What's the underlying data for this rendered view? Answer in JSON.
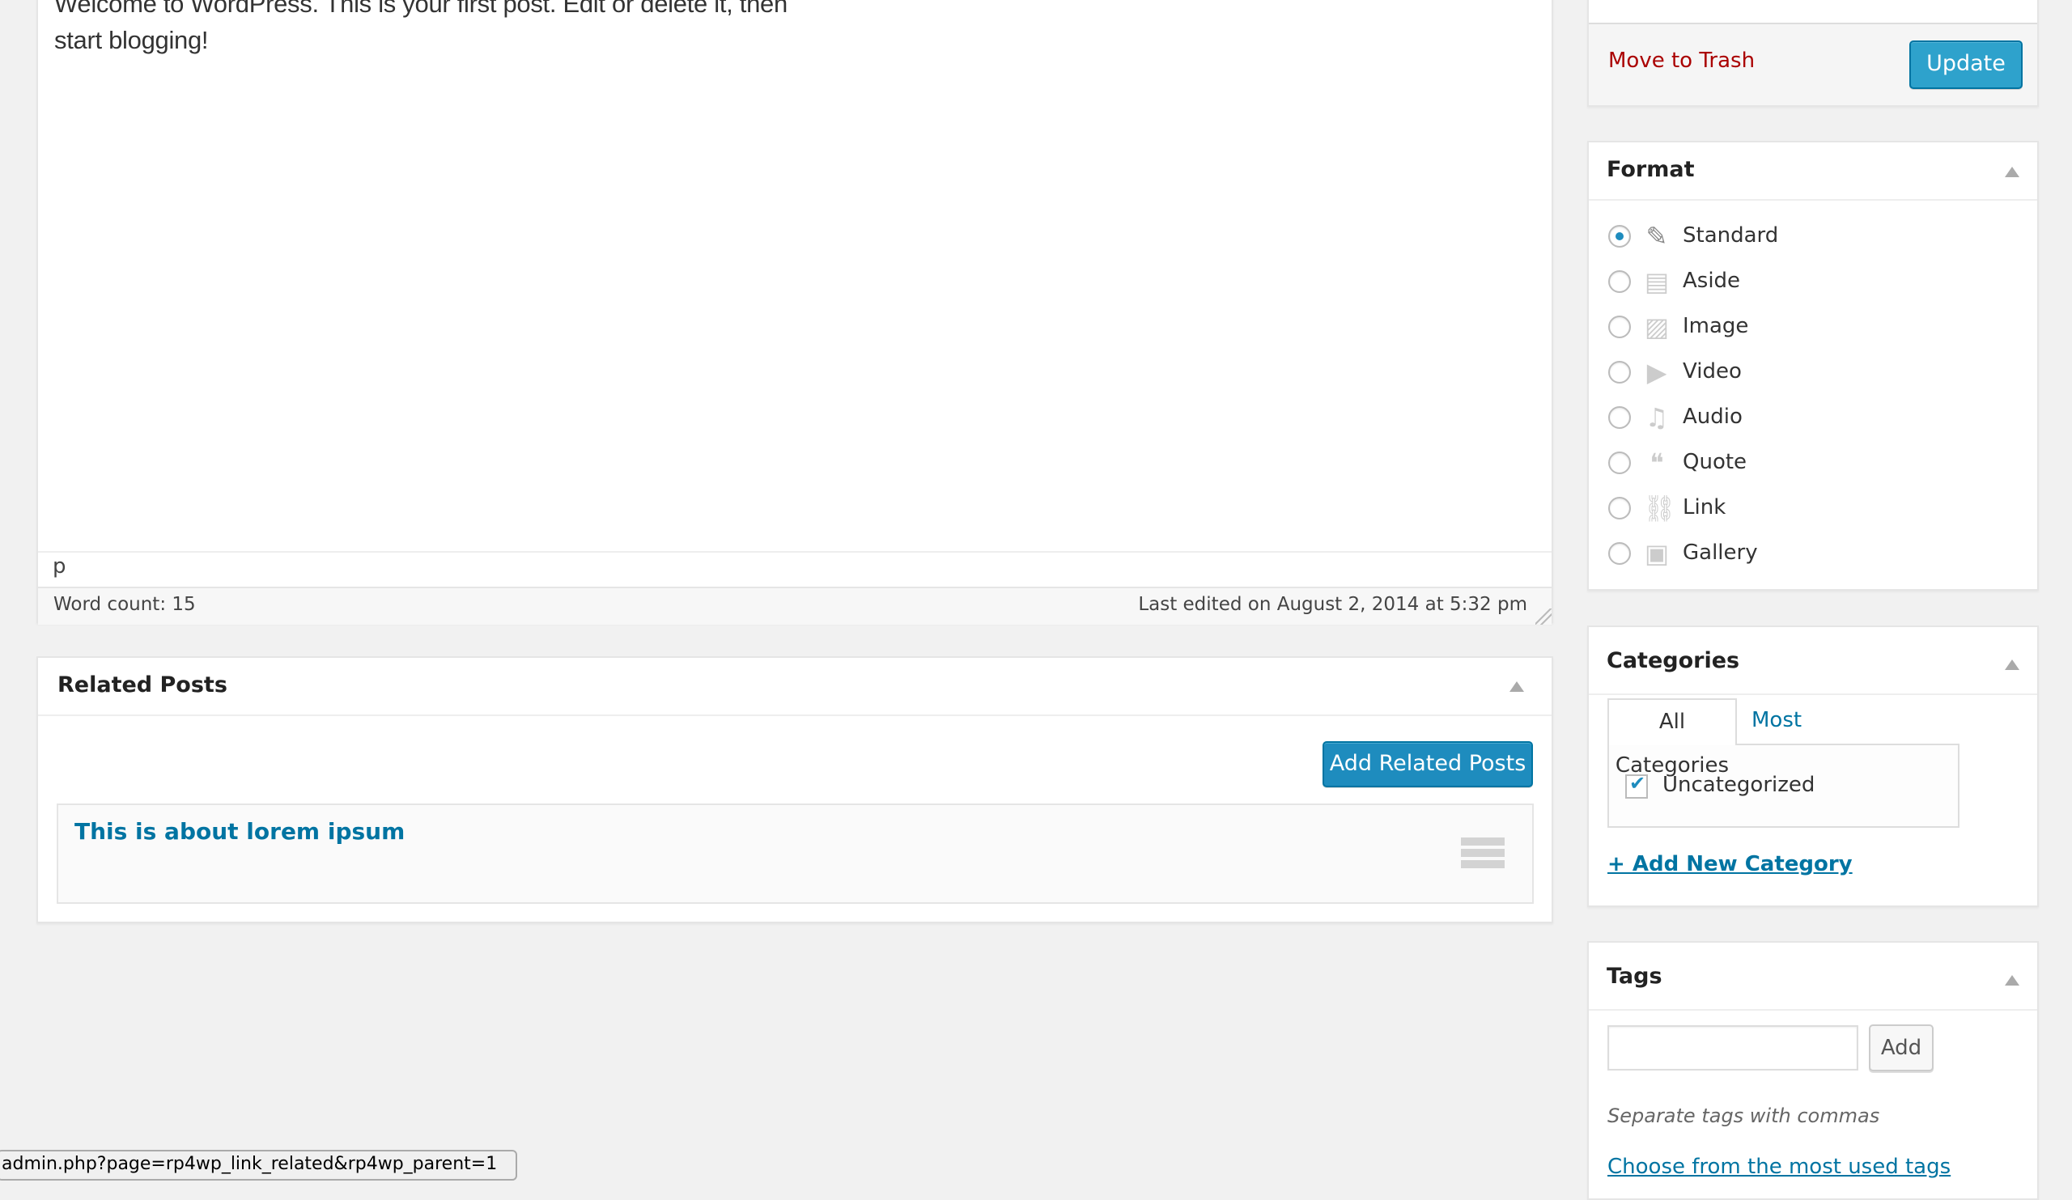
{
  "editor": {
    "content_lines": [
      "Welcome to WordPress. This is your first post. Edit or delete it, then",
      "start blogging!"
    ],
    "path": "p",
    "word_count": "Word count: 15",
    "last_edited": "Last edited on August 2, 2014 at 5:32 pm"
  },
  "related_posts": {
    "title": "Related Posts",
    "add_button": "Add Related Posts",
    "items": [
      {
        "title": "This is about lorem ipsum"
      }
    ]
  },
  "publish": {
    "move_to_trash": "Move to Trash",
    "update": "Update"
  },
  "format": {
    "title": "Format",
    "selected": "Standard",
    "options": [
      {
        "label": "Standard",
        "icon": "pushpin-icon",
        "glyph": "📌",
        "checked": true
      },
      {
        "label": "Aside",
        "icon": "aside-icon",
        "glyph": "▤",
        "checked": false
      },
      {
        "label": "Image",
        "icon": "image-icon",
        "glyph": "▨",
        "checked": false
      },
      {
        "label": "Video",
        "icon": "video-icon",
        "glyph": "▶",
        "checked": false
      },
      {
        "label": "Audio",
        "icon": "audio-icon",
        "glyph": "♫",
        "checked": false
      },
      {
        "label": "Quote",
        "icon": "quote-icon",
        "glyph": "❝",
        "checked": false
      },
      {
        "label": "Link",
        "icon": "link-icon",
        "glyph": "⛓",
        "checked": false
      },
      {
        "label": "Gallery",
        "icon": "gallery-icon",
        "glyph": "▣",
        "checked": false
      }
    ]
  },
  "categories": {
    "title": "Categories",
    "tabs": [
      "All Categories",
      "Most Used"
    ],
    "items": [
      {
        "label": "Uncategorized",
        "checked": true
      }
    ],
    "add_new": "+ Add New Category"
  },
  "tags": {
    "title": "Tags",
    "input_value": "",
    "add_button": "Add",
    "hint": "Separate tags with commas",
    "choose_link": "Choose from the most used tags"
  },
  "status_url": "admin.php?page=rp4wp_link_related&rp4wp_parent=1",
  "colors": {
    "primary": "#2ea2cc",
    "link": "#0074a2",
    "trash": "#aa0000",
    "background": "#f1f1f1"
  }
}
